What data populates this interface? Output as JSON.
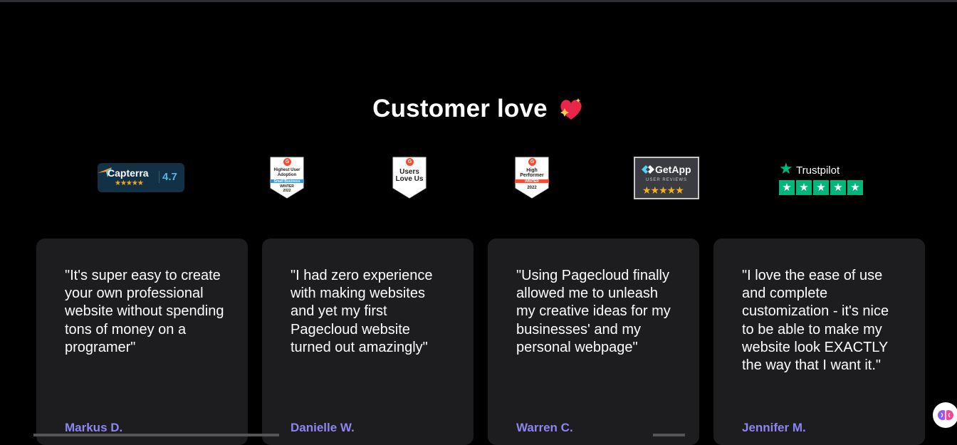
{
  "section": {
    "title": "Customer love"
  },
  "badges": {
    "capterra": {
      "name": "Capterra",
      "rating": "4.7",
      "stars": "★★★★★"
    },
    "g2_adoption": {
      "line1": "Highest User",
      "line2": "Adoption",
      "band": "Small Business",
      "season": "WINTER",
      "year": "2022"
    },
    "g2_love": {
      "line1": "Users",
      "line2": "Love Us"
    },
    "g2_performer": {
      "line1": "High",
      "line2": "Performer",
      "season": "WINTER",
      "year": "2022"
    },
    "getapp": {
      "name": "GetApp",
      "sub": "USER REVIEWS",
      "stars": "★★★★★"
    },
    "trustpilot": {
      "name": "Trustpilot",
      "star": "★",
      "boxes": [
        "★",
        "★",
        "★",
        "★",
        "★"
      ]
    }
  },
  "testimonials": [
    {
      "quote": "\"It's super easy to create your own professional website without spending tons of money on a programer\"",
      "author": "Markus D."
    },
    {
      "quote": "\"I had zero experience with making websites and yet my first Pagecloud website turned out amazingly\"",
      "author": "Danielle W."
    },
    {
      "quote": "\"Using Pagecloud finally allowed me to unleash my creative ideas for my businesses' and my personal webpage\"",
      "author": "Warren C."
    },
    {
      "quote": "\"I love the ease of use and complete customization - it's nice to be able to make my website look EXACTLY the way that I want it.\"",
      "author": "Jennifer M."
    }
  ],
  "colors": {
    "background": "#000000",
    "card": "#1d1d1f",
    "author": "#8b86f0",
    "trustpilot": "#00b67a",
    "g2": "#ff492c"
  },
  "icons": {
    "heart": "sparkling-heart-icon",
    "assistant": "brain-icon"
  }
}
